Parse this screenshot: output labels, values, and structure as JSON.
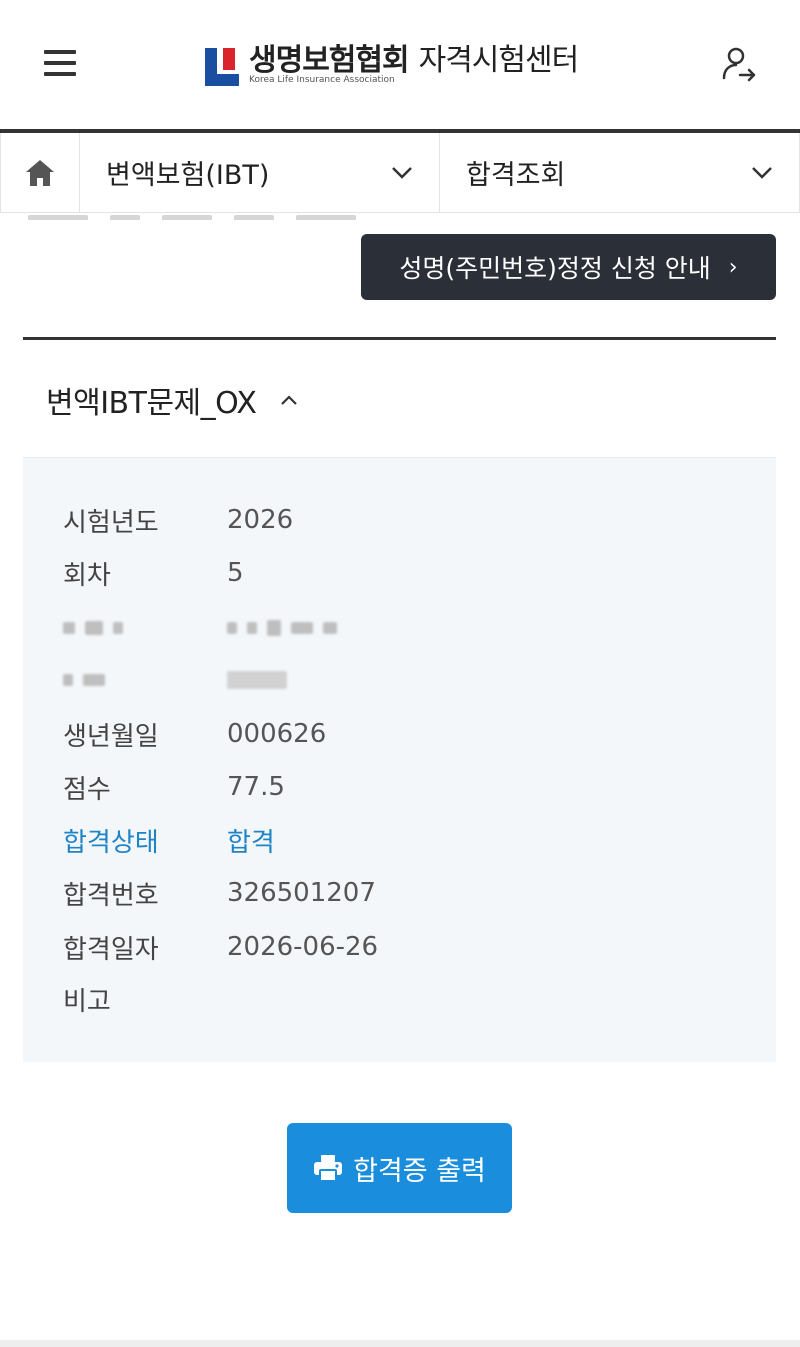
{
  "header": {
    "logo_title": "생명보험협회",
    "logo_subtitle": "자격시험센터",
    "logo_english": "Korea Life Insurance Association",
    "menu_icon": "hamburger-icon",
    "user_icon": "user-logout-icon"
  },
  "nav": {
    "home_icon": "home-icon",
    "category": "변액보험(IBT)",
    "page": "합격조회"
  },
  "notice_button": {
    "label": "성명(주민번호)정정 신청 안내",
    "chevron": "›"
  },
  "result": {
    "title": "변액IBT문제_OX",
    "expanded": true,
    "fields": [
      {
        "label": "시험년도",
        "value": "2026"
      },
      {
        "label": "회차",
        "value": "5"
      },
      {
        "label": "",
        "value": ""
      },
      {
        "label": "",
        "value": ""
      },
      {
        "label": "생년월일",
        "value": "000626"
      },
      {
        "label": "점수",
        "value": "77.5"
      },
      {
        "label": "합격상태",
        "value": "합격"
      },
      {
        "label": "합격번호",
        "value": "326501207"
      },
      {
        "label": "합격일자",
        "value": "2026-06-26"
      },
      {
        "label": "비고",
        "value": ""
      }
    ]
  },
  "print_button": {
    "label": "합격증 출력",
    "icon": "printer-icon"
  },
  "colors": {
    "accent": "#1a8ddc",
    "status": "#1f84c6",
    "dark_button": "#2b2f38",
    "panel_bg": "#f4f7fa",
    "logo_blue": "#1a4ea1",
    "logo_red": "#d9232d"
  }
}
